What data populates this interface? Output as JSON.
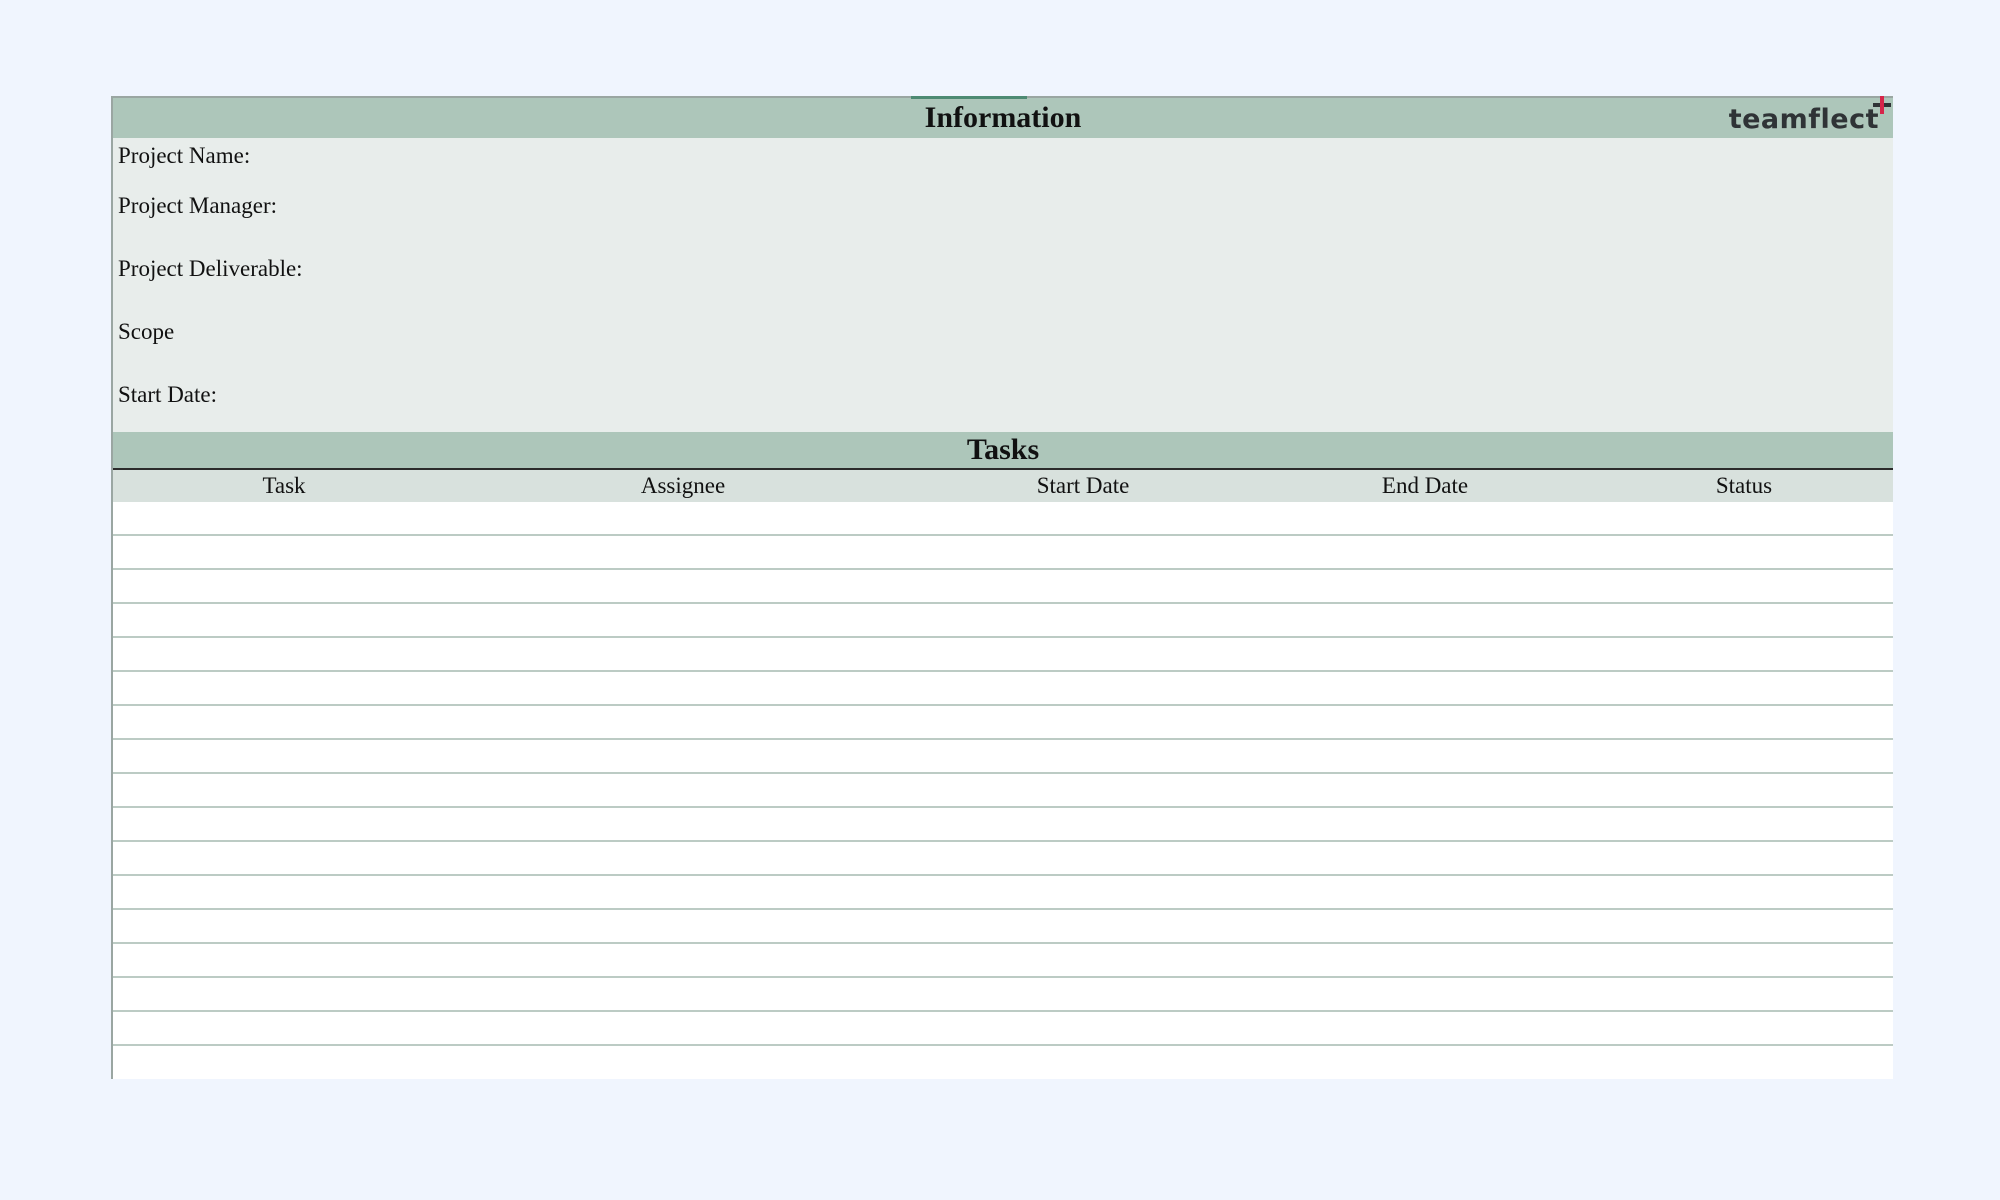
{
  "information": {
    "title": "Information",
    "logo": "teamflect",
    "fields": [
      {
        "label": "Project Name:"
      },
      {
        "label": "Project Manager:"
      },
      {
        "label": "Project Deliverable:"
      },
      {
        "label": "Scope"
      },
      {
        "label": "Start Date:"
      }
    ]
  },
  "tasks": {
    "title": "Tasks",
    "columns": [
      "Task",
      "Assignee",
      "Start Date",
      "End Date",
      "Status"
    ]
  },
  "colors": {
    "header_green": "#adc6ba",
    "info_background": "#e8edeb",
    "column_header": "#d8e1dd",
    "row_line": "#bccbc4",
    "logo_accent": "#d6254a"
  }
}
